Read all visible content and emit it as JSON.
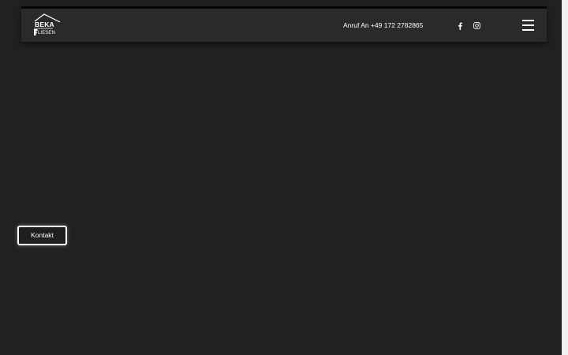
{
  "header": {
    "logo": {
      "name": "BEKA",
      "subtitle": "LIESEN"
    },
    "phone_text": "Anruf An +49 172 2782865",
    "social": [
      {
        "icon": "facebook-icon"
      },
      {
        "icon": "instagram-icon"
      }
    ],
    "menu_icon": "hamburger-menu-icon"
  },
  "contact_button": {
    "label": "Kontakt"
  },
  "colors": {
    "background": "#212121",
    "header_background": "#2a2a2a",
    "text": "#ffffff"
  }
}
